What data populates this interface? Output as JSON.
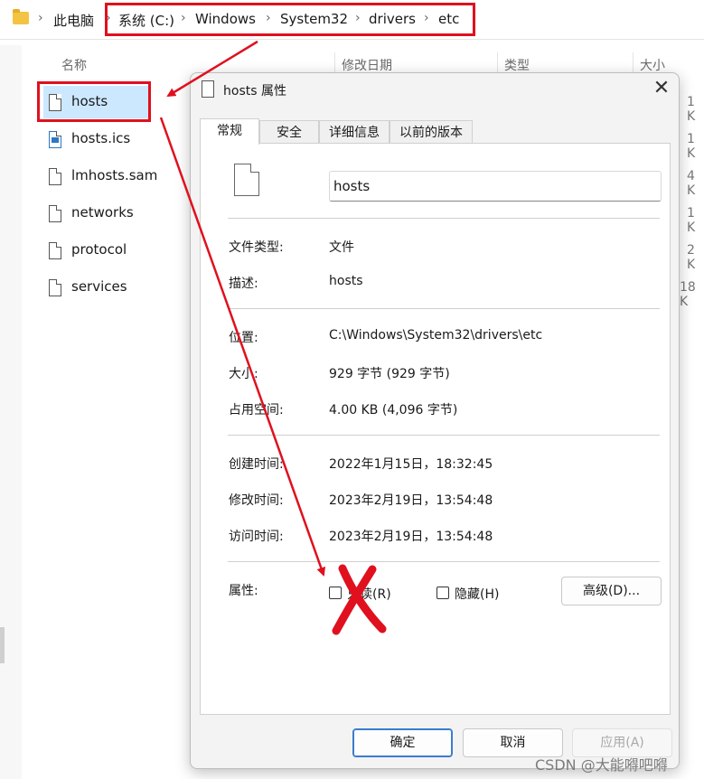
{
  "breadcrumb": {
    "items": [
      "此电脑",
      "系统 (C:)",
      "Windows",
      "System32",
      "drivers",
      "etc"
    ]
  },
  "columns": {
    "name": "名称",
    "modified": "修改日期",
    "type": "类型",
    "size": "大小"
  },
  "files": [
    {
      "name": "hosts",
      "size": "1 K",
      "icon": "file-icon",
      "selected": true
    },
    {
      "name": "hosts.ics",
      "size": "1 K",
      "icon": "ics-file-icon"
    },
    {
      "name": "lmhosts.sam",
      "size": "4 K",
      "icon": "file-icon"
    },
    {
      "name": "networks",
      "size": "1 K",
      "icon": "file-icon"
    },
    {
      "name": "protocol",
      "size": "2 K",
      "icon": "file-icon"
    },
    {
      "name": "services",
      "size": "18 K",
      "icon": "file-icon"
    }
  ],
  "dialog": {
    "title": "hosts 属性",
    "close": "✕",
    "tabs": [
      "常规",
      "安全",
      "详细信息",
      "以前的版本"
    ],
    "filename_value": "hosts",
    "props": {
      "type_label": "文件类型:",
      "type_value": "文件",
      "desc_label": "描述:",
      "desc_value": "hosts",
      "location_label": "位置:",
      "location_value": "C:\\Windows\\System32\\drivers\\etc",
      "size_label": "大小:",
      "size_value": "929 字节 (929 字节)",
      "disk_label": "占用空间:",
      "disk_value": "4.00 KB (4,096 字节)",
      "created_label": "创建时间:",
      "created_value": "2022年1月15日，18:32:45",
      "modified_label": "修改时间:",
      "modified_value": "2023年2月19日，13:54:48",
      "accessed_label": "访问时间:",
      "accessed_value": "2023年2月19日，13:54:48",
      "attrs_label": "属性:"
    },
    "readonly_label": "只读(R)",
    "hidden_label": "隐藏(H)",
    "advanced_button": "高级(D)...",
    "ok_button": "确定",
    "cancel_button": "取消",
    "apply_button": "应用(A)"
  },
  "annotation_color": "#e0101e",
  "watermark": "CSDN @大能嘚吧嘚"
}
